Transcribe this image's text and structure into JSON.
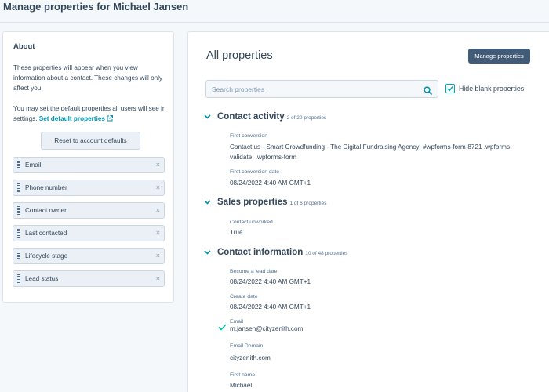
{
  "page": {
    "title": "Manage properties for Michael Jansen"
  },
  "about": {
    "heading": "About",
    "description": "These properties will appear when you view information about a contact. These changes will only affect you.",
    "default_text": "You may set the default properties all users will see in settings.",
    "default_link": "Set default properties",
    "reset_label": "Reset to account defaults",
    "properties": [
      {
        "label": "Email"
      },
      {
        "label": "Phone number"
      },
      {
        "label": "Contact owner"
      },
      {
        "label": "Last contacted"
      },
      {
        "label": "Lifecycle stage"
      },
      {
        "label": "Lead status"
      }
    ],
    "remove_glyph": "×"
  },
  "main": {
    "title": "All properties",
    "manage_label": "Manage properties",
    "search_placeholder": "Search properties",
    "hide_blank_label": "Hide blank properties",
    "hide_blank_checked": true,
    "sections": [
      {
        "title": "Contact activity",
        "count": "2 of 20 properties",
        "fields": [
          {
            "label": "First conversion",
            "value": "Contact us - Smart Crowdfunding - The Digital Fundraising Agency: #wpforms-form-8721 .wpforms-validate, .wpforms-form"
          },
          {
            "label": "First conversion date",
            "value": "08/24/2022 4:40 AM GMT+1"
          }
        ]
      },
      {
        "title": "Sales properties",
        "count": "1 of 6 properties",
        "fields": [
          {
            "label": "Contact unworked",
            "value": "True"
          }
        ]
      },
      {
        "title": "Contact information",
        "count": "10 of 48 properties",
        "fields": [
          {
            "label": "Become a lead date",
            "value": "08/24/2022 4:40 AM GMT+1"
          },
          {
            "label": "Create date",
            "value": "08/24/2022 4:40 AM GMT+1"
          },
          {
            "label": "Email",
            "value": "m.jansen@cityzenith.com",
            "verified": true
          },
          {
            "label": "Email Domain",
            "value": "cityzenith.com"
          },
          {
            "label": "First name",
            "value": "Michael"
          }
        ]
      }
    ]
  },
  "icons": {
    "search": "search-icon",
    "chevron": "chevron-down-icon",
    "external_link": "external-link-icon",
    "drag_handle": "drag-handle-icon",
    "remove": "close-icon",
    "check": "checkmark-icon"
  },
  "colors": {
    "accent": "#00a4bd",
    "link": "#0091ae",
    "primary_button": "#425b76",
    "text": "#33475b",
    "chip_bg": "#eaf0f6",
    "verified": "#00bda5"
  }
}
